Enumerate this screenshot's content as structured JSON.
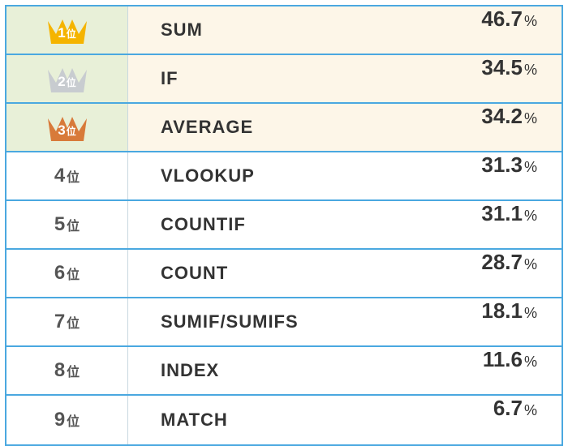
{
  "rank_suffix": "位",
  "percent_sign": "%",
  "rows": [
    {
      "rank": "1",
      "name": "SUM",
      "pct": "46.7",
      "tier": "gold"
    },
    {
      "rank": "2",
      "name": "IF",
      "pct": "34.5",
      "tier": "silver"
    },
    {
      "rank": "3",
      "name": "AVERAGE",
      "pct": "34.2",
      "tier": "bronze"
    },
    {
      "rank": "4",
      "name": "VLOOKUP",
      "pct": "31.3",
      "tier": "plain"
    },
    {
      "rank": "5",
      "name": "COUNTIF",
      "pct": "31.1",
      "tier": "plain"
    },
    {
      "rank": "6",
      "name": "COUNT",
      "pct": "28.7",
      "tier": "plain"
    },
    {
      "rank": "7",
      "name": "SUMIF/SUMIFS",
      "pct": "18.1",
      "tier": "plain"
    },
    {
      "rank": "8",
      "name": "INDEX",
      "pct": "11.6",
      "tier": "plain"
    },
    {
      "rank": "9",
      "name": "MATCH",
      "pct": "6.7",
      "tier": "plain"
    }
  ],
  "crown_colors": {
    "gold": {
      "fill": "#f5b400",
      "stroke": "#e09a00"
    },
    "silver": {
      "fill": "#c8ccd0",
      "stroke": "#a8aeb4"
    },
    "bronze": {
      "fill": "#d87a3a",
      "stroke": "#b85f25"
    }
  }
}
